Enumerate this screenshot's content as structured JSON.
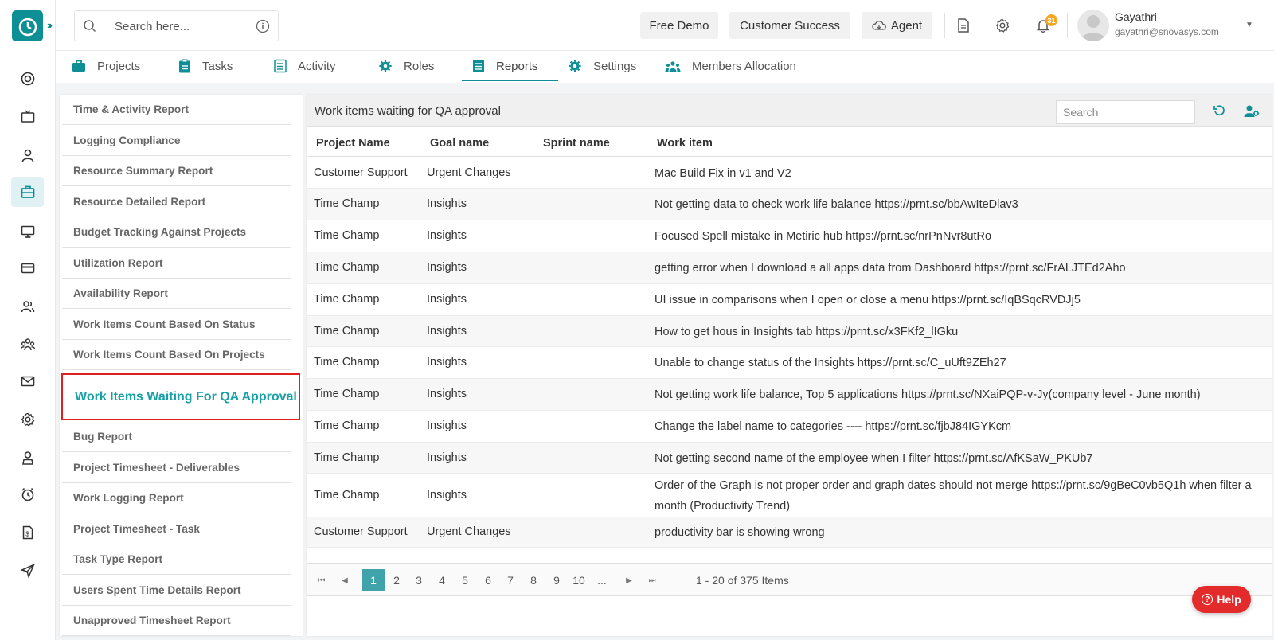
{
  "header": {
    "search_placeholder": "Search here...",
    "free_demo": "Free Demo",
    "customer_success": "Customer Success",
    "agent": "Agent",
    "notification_count": "31",
    "user_name": "Gayathri",
    "user_email": "gayathri@snovasys.com"
  },
  "tabs": [
    {
      "label": "Projects",
      "icon": "briefcase-icon"
    },
    {
      "label": "Tasks",
      "icon": "clipboard-icon"
    },
    {
      "label": "Activity",
      "icon": "list-icon"
    },
    {
      "label": "Roles",
      "icon": "gear-icon"
    },
    {
      "label": "Reports",
      "icon": "report-icon",
      "active": true
    },
    {
      "label": "Settings",
      "icon": "gear-icon"
    },
    {
      "label": "Members Allocation",
      "icon": "members-icon"
    }
  ],
  "reports": [
    "Time & Activity Report",
    "Logging Compliance",
    "Resource Summary Report",
    "Resource Detailed Report",
    "Budget Tracking Against Projects",
    "Utilization Report",
    "Availability Report",
    "Work Items Count Based On Status",
    "Work Items Count Based On Projects",
    "Work Items Waiting For QA Approval",
    "Bug Report",
    "Project Timesheet - Deliverables",
    "Work Logging Report",
    "Project Timesheet - Task",
    "Task Type Report",
    "Users Spent Time Details Report",
    "Unapproved Timesheet Report"
  ],
  "grid": {
    "title": "Work items waiting for QA approval",
    "search_placeholder": "Search",
    "columns": [
      "Project Name",
      "Goal name",
      "Sprint name",
      "Work item"
    ],
    "rows": [
      [
        "Customer Support",
        "Urgent Changes",
        "",
        "Mac Build Fix in v1 and V2"
      ],
      [
        "Time Champ",
        "Insights",
        "",
        "Not getting data to check work life balance https://prnt.sc/bbAwIteDlav3"
      ],
      [
        "Time Champ",
        "Insights",
        "",
        "Focused Spell mistake in Metiric hub https://prnt.sc/nrPnNvr8utRo"
      ],
      [
        "Time Champ",
        "Insights",
        "",
        "getting error when I download a all apps data from Dashboard https://prnt.sc/FrALJTEd2Aho"
      ],
      [
        "Time Champ",
        "Insights",
        "",
        "UI issue in comparisons when I open or close a menu https://prnt.sc/IqBSqcRVDJj5"
      ],
      [
        "Time Champ",
        "Insights",
        "",
        "How to get hous in Insights tab https://prnt.sc/x3FKf2_lIGku"
      ],
      [
        "Time Champ",
        "Insights",
        "",
        "Unable to change status of the Insights https://prnt.sc/C_uUft9ZEh27"
      ],
      [
        "Time Champ",
        "Insights",
        "",
        "Not getting work life balance, Top 5 applications https://prnt.sc/NXaiPQP-v-Jy(company level - June month)"
      ],
      [
        "Time Champ",
        "Insights",
        "",
        "Change the label name to categories ---- https://prnt.sc/fjbJ84IGYKcm"
      ],
      [
        "Time Champ",
        "Insights",
        "",
        "Not getting second name of the employee when I filter https://prnt.sc/AfKSaW_PKUb7"
      ],
      [
        "Time Champ",
        "Insights",
        "",
        "Order of the Graph is not proper order and graph dates should not merge https://prnt.sc/9gBeC0vb5Q1h when filter a month (Productivity Trend)"
      ],
      [
        "Customer Support",
        "Urgent Changes",
        "",
        "productivity bar is showing wrong"
      ]
    ]
  },
  "pager": {
    "pages": [
      "1",
      "2",
      "3",
      "4",
      "5",
      "6",
      "7",
      "8",
      "9",
      "10",
      "..."
    ],
    "current": "1",
    "info": "1 - 20 of 375 Items"
  },
  "help_label": "Help",
  "colors": {
    "accent": "#0e8f95",
    "highlight_border": "#e02020",
    "help": "#e32b2b"
  }
}
